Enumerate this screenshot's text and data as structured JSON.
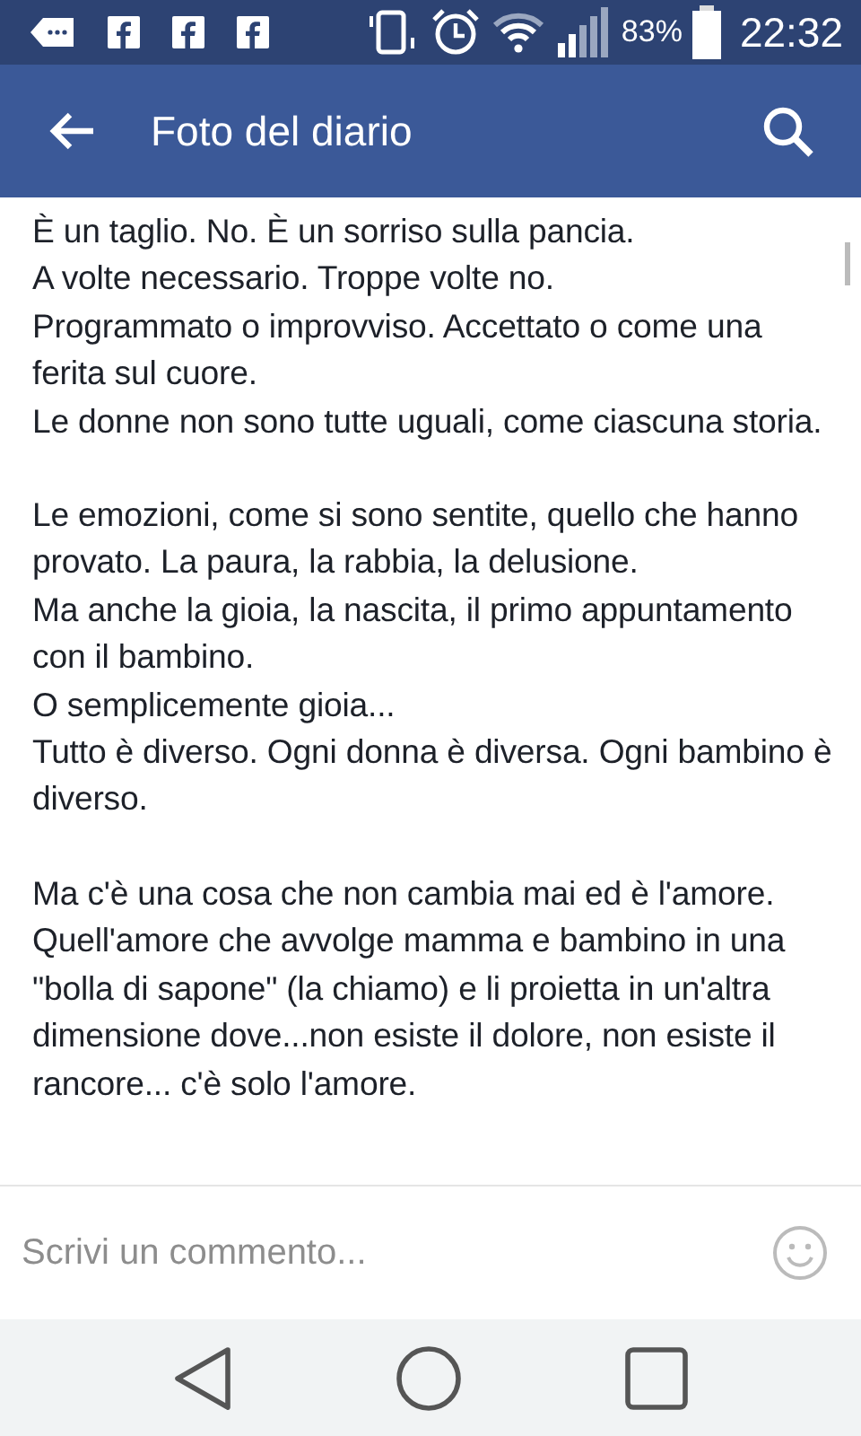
{
  "status_bar": {
    "battery": "83%",
    "time": "22:32"
  },
  "app_bar": {
    "title": "Foto del diario"
  },
  "post": {
    "paragraphs": [
      [
        "È un taglio. No. È un sorriso sulla pancia.",
        "A volte necessario. Troppe volte no.",
        "Programmato o improvviso. Accettato o come una ferita sul cuore.",
        "Le donne non sono tutte uguali, come ciascuna storia."
      ],
      [
        "Le emozioni, come si sono sentite, quello che hanno provato. La paura, la rabbia, la delusione.",
        "Ma anche la gioia, la nascita, il primo appuntamento con il bambino.",
        "O semplicemente gioia...",
        "Tutto è diverso. Ogni donna è diversa. Ogni bambino è diverso."
      ],
      [
        "Ma c'è una cosa che non cambia mai ed è l'amore.",
        "Quell'amore che avvolge mamma e bambino in una \"bolla di sapone\" (la chiamo) e li proietta in un'altra dimensione dove...non esiste il dolore, non esiste il rancore... c'è solo l'amore."
      ]
    ]
  },
  "comment": {
    "placeholder": "Scrivi un commento..."
  }
}
